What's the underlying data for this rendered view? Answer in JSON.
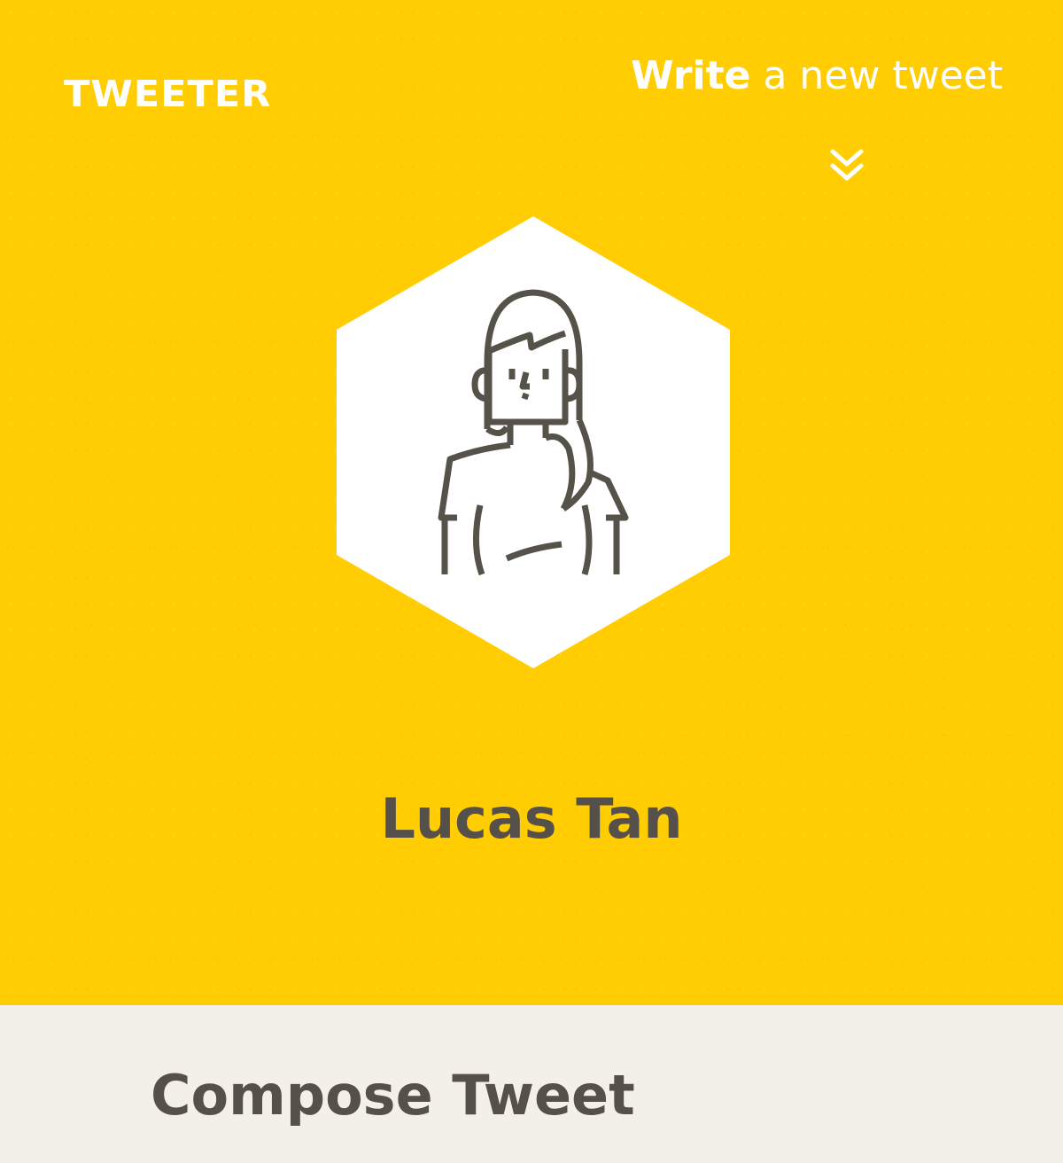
{
  "header": {
    "logo_text": "TWEETER",
    "write_link_bold": "Write",
    "write_link_rest": " a new tweet",
    "scroll_icon": "double-chevron-down-icon"
  },
  "profile": {
    "avatar_icon": "female-user-avatar-icon",
    "name": "Lucas Tan"
  },
  "compose": {
    "title": "Compose Tweet"
  },
  "colors": {
    "hero_background": "#ffcd02",
    "text_dark": "#555049",
    "text_light": "#ffffff",
    "section_background": "#f3f0ea",
    "avatar_stroke": "#55524a"
  }
}
